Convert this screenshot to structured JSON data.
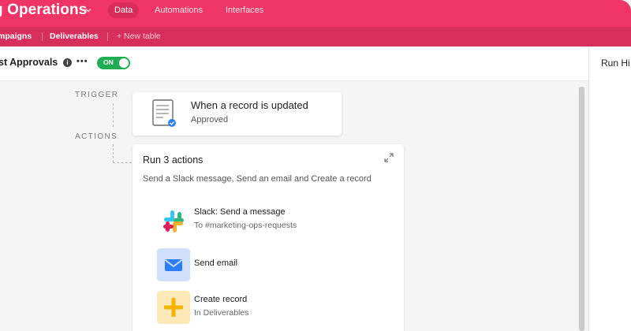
{
  "header": {
    "base_name": "g Operations",
    "nav_tabs": [
      {
        "label": "Data",
        "active": true
      },
      {
        "label": "Automations",
        "active": false
      },
      {
        "label": "Interfaces",
        "active": false
      }
    ],
    "brand_color": "#ef3566"
  },
  "tables": {
    "items": [
      "mpaigns",
      "Deliverables"
    ],
    "new_table": "+ New table"
  },
  "automation": {
    "name": "st Approvals",
    "toggle_label": "ON",
    "toggle_color": "#1fae52"
  },
  "right_panel": {
    "title": "Run Hi"
  },
  "flow": {
    "trigger_label": "TRIGGER",
    "actions_label": "ACTIONS",
    "trigger": {
      "title": "When a record is updated",
      "subtitle": "Approved",
      "icon": "record-document-icon"
    },
    "actions_group": {
      "title": "Run 3 actions",
      "subtitle": "Send a Slack message, Send an email and Create a record",
      "items": [
        {
          "title": "Slack: Send a message",
          "subtitle": "To #marketing-ops-requests",
          "icon": "slack-icon"
        },
        {
          "title": "Send email",
          "subtitle": "",
          "icon": "envelope-icon"
        },
        {
          "title": "Create record",
          "subtitle": "In Deliverables",
          "icon": "plus-icon"
        }
      ]
    }
  }
}
